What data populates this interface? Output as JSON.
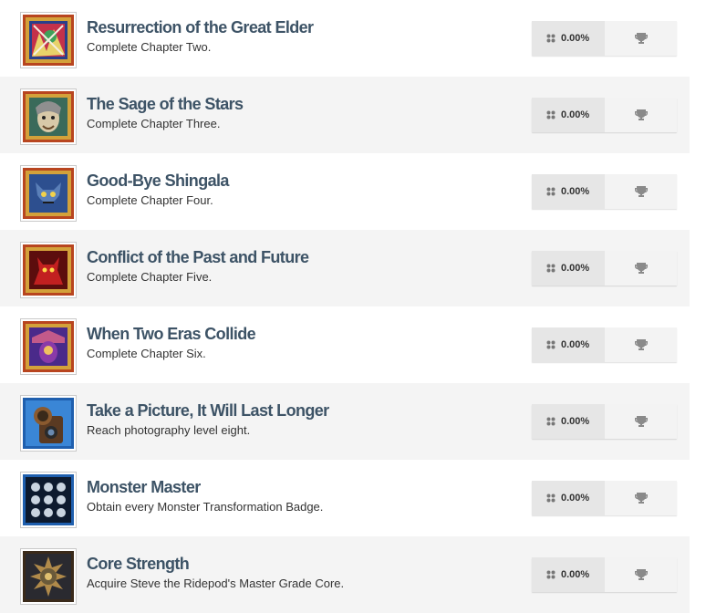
{
  "achievements": [
    {
      "title": "Resurrection of the Great Elder",
      "description": "Complete Chapter Two.",
      "percent": "0.00%",
      "icon": "great-elder-card-icon"
    },
    {
      "title": "The Sage of the Stars",
      "description": "Complete Chapter Three.",
      "percent": "0.00%",
      "icon": "star-sage-card-icon"
    },
    {
      "title": "Good-Bye Shingala",
      "description": "Complete Chapter Four.",
      "percent": "0.00%",
      "icon": "shingala-card-icon"
    },
    {
      "title": "Conflict of the Past and Future",
      "description": "Complete Chapter Five.",
      "percent": "0.00%",
      "icon": "demon-card-icon"
    },
    {
      "title": "When Two Eras Collide",
      "description": "Complete Chapter Six.",
      "percent": "0.00%",
      "icon": "two-eras-card-icon"
    },
    {
      "title": "Take a Picture, It Will Last Longer",
      "description": "Reach photography level eight.",
      "percent": "0.00%",
      "icon": "camera-icon"
    },
    {
      "title": "Monster Master",
      "description": "Obtain every Monster Transformation Badge.",
      "percent": "0.00%",
      "icon": "monster-badges-icon"
    },
    {
      "title": "Core Strength",
      "description": "Acquire Steve the Ridepod's Master Grade Core.",
      "percent": "0.00%",
      "icon": "ridepod-core-icon"
    }
  ],
  "colors": {
    "title": "#3d5366",
    "row_alt": "#f4f4f4",
    "card_border": "#b8451f",
    "card_frame": "#c7932f"
  }
}
